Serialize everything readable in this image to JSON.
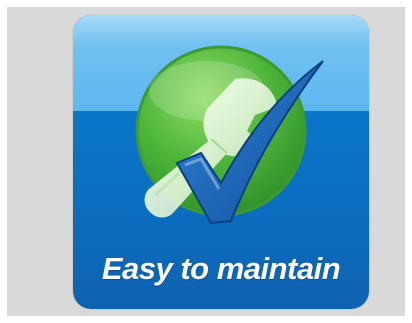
{
  "badge": {
    "caption": "Easy to maintain",
    "icon": "wrench-checkmark-icon"
  },
  "colors": {
    "background": "#d9d9d9",
    "tile_top": "#6cbff1",
    "tile_bottom": "#0a6fc2",
    "circle": "#4fb63d",
    "checkmark": "#1a5fb4",
    "text": "#ffffff"
  }
}
